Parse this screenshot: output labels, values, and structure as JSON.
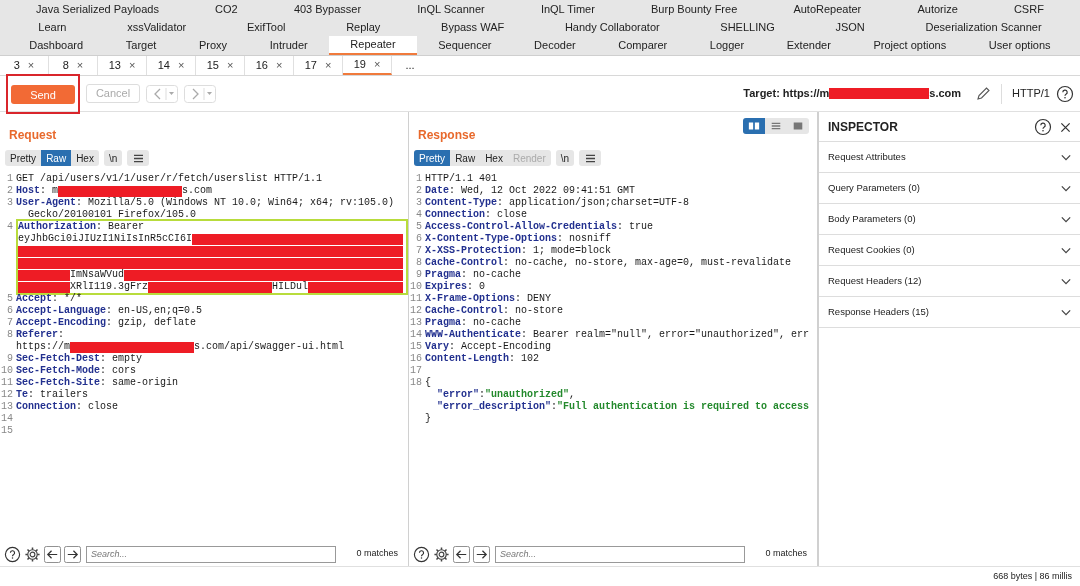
{
  "extension_tabs": [
    [
      "Java Serialized Payloads",
      "CO2",
      "403 Bypasser",
      "InQL Scanner",
      "InQL Timer",
      "Burp Bounty Free",
      "AutoRepeater",
      "Autorize",
      "CSRF"
    ],
    [
      "Learn",
      "xssValidator",
      "ExifTool",
      "Replay",
      "Bypass WAF",
      "Handy Collaborator",
      "SHELLING",
      "JSON",
      "Deserialization Scanner"
    ]
  ],
  "main_tabs": [
    {
      "label": "Dashboard",
      "selected": false
    },
    {
      "label": "Target",
      "selected": false
    },
    {
      "label": "Proxy",
      "selected": false
    },
    {
      "label": "Intruder",
      "selected": false
    },
    {
      "label": "Repeater",
      "selected": true
    },
    {
      "label": "Sequencer",
      "selected": false
    },
    {
      "label": "Decoder",
      "selected": false
    },
    {
      "label": "Comparer",
      "selected": false
    },
    {
      "label": "Logger",
      "selected": false
    },
    {
      "label": "Extender",
      "selected": false
    },
    {
      "label": "Project options",
      "selected": false
    },
    {
      "label": "User options",
      "selected": false
    }
  ],
  "repeater_tabs": [
    {
      "label": "3",
      "close": "×",
      "selected": false
    },
    {
      "label": "8",
      "close": "×",
      "selected": false
    },
    {
      "label": "13",
      "close": "×",
      "selected": false
    },
    {
      "label": "14",
      "close": "×",
      "selected": false
    },
    {
      "label": "15",
      "close": "×",
      "selected": false
    },
    {
      "label": "16",
      "close": "×",
      "selected": false
    },
    {
      "label": "17",
      "close": "×",
      "selected": false
    },
    {
      "label": "19",
      "close": "×",
      "selected": true
    }
  ],
  "more_tabs": "...",
  "toolbar": {
    "send": {
      "label": "Send",
      "annotated": true
    },
    "cancel": {
      "label": "Cancel",
      "disabled": true
    },
    "target": [
      {
        "kind": "plain",
        "text": "Target: https://m"
      },
      {
        "kind": "redacted"
      },
      {
        "kind": "plain",
        "text": "s.com"
      }
    ],
    "protocol": "HTTP/1"
  },
  "request": {
    "title": "Request",
    "views": [
      {
        "label": "Pretty",
        "selected": false,
        "disabled": false
      },
      {
        "label": "Raw",
        "selected": true,
        "disabled": false
      },
      {
        "label": "Hex",
        "selected": false,
        "disabled": false
      }
    ],
    "newline_toggle": "\\n",
    "lines": [
      {
        "number": "1",
        "segments": [
          {
            "kind": "plain",
            "text": "GET /api/users/v1/1/user/r/fetch/userslist HTTP/1.1"
          }
        ]
      },
      {
        "number": "2",
        "segments": [
          {
            "kind": "key",
            "text": "Host"
          },
          {
            "kind": "plain",
            "text": ": m"
          },
          {
            "kind": "redacted"
          },
          {
            "kind": "plain",
            "text": "s.com"
          }
        ]
      },
      {
        "number": "3",
        "segments": [
          {
            "kind": "key",
            "text": "User-Agent"
          },
          {
            "kind": "plain",
            "text": ": Mozilla/5.0 (Windows NT 10.0; Win64; x64; rv:105.0)"
          },
          {
            "kind": "break"
          },
          {
            "kind": "indent"
          },
          {
            "kind": "plain",
            "text": "Gecko/20100101 Firefox/105.0"
          }
        ]
      },
      {
        "number": "4",
        "annotated": true,
        "segments": [
          {
            "kind": "key",
            "text": "Authorization"
          },
          {
            "kind": "plain",
            "text": ": Bearer"
          },
          {
            "kind": "break"
          },
          {
            "kind": "plain",
            "text": "eyJhbGci0iJIUzI1NiIsInR5cCI6I"
          },
          {
            "kind": "redacted"
          },
          {
            "kind": "break"
          },
          {
            "kind": "redacted"
          },
          {
            "kind": "break"
          },
          {
            "kind": "redacted"
          },
          {
            "kind": "break"
          },
          {
            "kind": "redacted"
          },
          {
            "kind": "plain",
            "text": "ImNsaWVud"
          },
          {
            "kind": "redacted"
          },
          {
            "kind": "break"
          },
          {
            "kind": "redacted"
          },
          {
            "kind": "plain",
            "text": "XRlI119.3gFrz"
          },
          {
            "kind": "redacted"
          },
          {
            "kind": "plain",
            "text": "HILDul"
          },
          {
            "kind": "redacted"
          }
        ]
      },
      {
        "number": "5",
        "segments": [
          {
            "kind": "key",
            "text": "Accept"
          },
          {
            "kind": "plain",
            "text": ": */*"
          }
        ]
      },
      {
        "number": "6",
        "segments": [
          {
            "kind": "key",
            "text": "Accept-Language"
          },
          {
            "kind": "plain",
            "text": ": en-US,en;q=0.5"
          }
        ]
      },
      {
        "number": "7",
        "segments": [
          {
            "kind": "key",
            "text": "Accept-Encoding"
          },
          {
            "kind": "plain",
            "text": ": gzip, deflate"
          }
        ]
      },
      {
        "number": "8",
        "segments": [
          {
            "kind": "key",
            "text": "Referer"
          },
          {
            "kind": "plain",
            "text": ":"
          },
          {
            "kind": "break"
          },
          {
            "kind": "plain",
            "text": "https://m"
          },
          {
            "kind": "redacted"
          },
          {
            "kind": "plain",
            "text": "s.com/api/swagger-ui.html"
          }
        ]
      },
      {
        "number": "9",
        "segments": [
          {
            "kind": "key",
            "text": "Sec-Fetch-Dest"
          },
          {
            "kind": "plain",
            "text": ": empty"
          }
        ]
      },
      {
        "number": "10",
        "segments": [
          {
            "kind": "key",
            "text": "Sec-Fetch-Mode"
          },
          {
            "kind": "plain",
            "text": ": cors"
          }
        ]
      },
      {
        "number": "11",
        "segments": [
          {
            "kind": "key",
            "text": "Sec-Fetch-Site"
          },
          {
            "kind": "plain",
            "text": ": same-origin"
          }
        ]
      },
      {
        "number": "12",
        "segments": [
          {
            "kind": "key",
            "text": "Te"
          },
          {
            "kind": "plain",
            "text": ": trailers"
          }
        ]
      },
      {
        "number": "13",
        "segments": [
          {
            "kind": "key",
            "text": "Connection"
          },
          {
            "kind": "plain",
            "text": ": close"
          }
        ]
      },
      {
        "number": "14"
      },
      {
        "number": "15"
      }
    ],
    "search": {
      "placeholder": "Search...",
      "matches": "0 matches"
    }
  },
  "response": {
    "title": "Response",
    "layout_buttons": [
      {
        "kind": "columns",
        "selected": true
      },
      {
        "kind": "rows",
        "selected": false
      },
      {
        "kind": "single",
        "selected": false
      }
    ],
    "views": [
      {
        "label": "Pretty",
        "selected": true,
        "disabled": false
      },
      {
        "label": "Raw",
        "selected": false,
        "disabled": false
      },
      {
        "label": "Hex",
        "selected": false,
        "disabled": false
      },
      {
        "label": "Render",
        "selected": false,
        "disabled": true
      }
    ],
    "newline_toggle": "\\n",
    "lines": [
      {
        "number": "1",
        "segments": [
          {
            "kind": "plain",
            "text": "HTTP/1.1 401"
          }
        ]
      },
      {
        "number": "2",
        "segments": [
          {
            "kind": "key",
            "text": "Date"
          },
          {
            "kind": "plain",
            "text": ": Wed, 12 Oct 2022 09:41:51 GMT"
          }
        ]
      },
      {
        "number": "3",
        "segments": [
          {
            "kind": "key",
            "text": "Content-Type"
          },
          {
            "kind": "plain",
            "text": ": application/json;charset=UTF-8"
          }
        ]
      },
      {
        "number": "4",
        "segments": [
          {
            "kind": "key",
            "text": "Connection"
          },
          {
            "kind": "plain",
            "text": ": close"
          }
        ]
      },
      {
        "number": "5",
        "segments": [
          {
            "kind": "key",
            "text": "Access-Control-Allow-Credentials"
          },
          {
            "kind": "plain",
            "text": ": true"
          }
        ]
      },
      {
        "number": "6",
        "segments": [
          {
            "kind": "key",
            "text": "X-Content-Type-Options"
          },
          {
            "kind": "plain",
            "text": ": nosniff"
          }
        ]
      },
      {
        "number": "7",
        "segments": [
          {
            "kind": "key",
            "text": "X-XSS-Protection"
          },
          {
            "kind": "plain",
            "text": ": 1; mode=block"
          }
        ]
      },
      {
        "number": "8",
        "segments": [
          {
            "kind": "key",
            "text": "Cache-Control"
          },
          {
            "kind": "plain",
            "text": ": no-cache, no-store, max-age=0, must-revalidate"
          }
        ]
      },
      {
        "number": "9",
        "segments": [
          {
            "kind": "key",
            "text": "Pragma"
          },
          {
            "kind": "plain",
            "text": ": no-cache"
          }
        ]
      },
      {
        "number": "10",
        "segments": [
          {
            "kind": "key",
            "text": "Expires"
          },
          {
            "kind": "plain",
            "text": ": 0"
          }
        ]
      },
      {
        "number": "11",
        "segments": [
          {
            "kind": "key",
            "text": "X-Frame-Options"
          },
          {
            "kind": "plain",
            "text": ": DENY"
          }
        ]
      },
      {
        "number": "12",
        "segments": [
          {
            "kind": "key",
            "text": "Cache-Control"
          },
          {
            "kind": "plain",
            "text": ": no-store"
          }
        ]
      },
      {
        "number": "13",
        "segments": [
          {
            "kind": "key",
            "text": "Pragma"
          },
          {
            "kind": "plain",
            "text": ": no-cache"
          }
        ]
      },
      {
        "number": "14",
        "segments": [
          {
            "kind": "key",
            "text": "WWW-Authenticate"
          },
          {
            "kind": "plain",
            "text": ": Bearer realm=\"null\", error=\"unauthorized\", err"
          }
        ]
      },
      {
        "number": "15",
        "segments": [
          {
            "kind": "key",
            "text": "Vary"
          },
          {
            "kind": "plain",
            "text": ": Accept-Encoding"
          }
        ]
      },
      {
        "number": "16",
        "segments": [
          {
            "kind": "key",
            "text": "Content-Length"
          },
          {
            "kind": "plain",
            "text": ": 102"
          }
        ]
      },
      {
        "number": "17"
      },
      {
        "number": "18",
        "segments": [
          {
            "kind": "plain",
            "text": "{"
          },
          {
            "kind": "break"
          },
          {
            "kind": "indent"
          },
          {
            "kind": "jkey",
            "text": "\"error\""
          },
          {
            "kind": "plain",
            "text": ":"
          },
          {
            "kind": "jstr",
            "text": "\"unauthorized\""
          },
          {
            "kind": "plain",
            "text": ","
          },
          {
            "kind": "break"
          },
          {
            "kind": "indent"
          },
          {
            "kind": "jkey",
            "text": "\"error_description\""
          },
          {
            "kind": "plain",
            "text": ":"
          },
          {
            "kind": "jstr",
            "text": "\"Full authentication is required to access"
          },
          {
            "kind": "break"
          },
          {
            "kind": "plain",
            "text": "}"
          }
        ]
      }
    ],
    "search": {
      "placeholder": "Search...",
      "matches": "0 matches"
    }
  },
  "inspector": {
    "title": "INSPECTOR",
    "sections": [
      "Request Attributes",
      "Query Parameters (0)",
      "Body Parameters (0)",
      "Request Cookies (0)",
      "Request Headers (12)",
      "Response Headers (15)"
    ]
  },
  "status_bar": "668 bytes | 86 millis"
}
